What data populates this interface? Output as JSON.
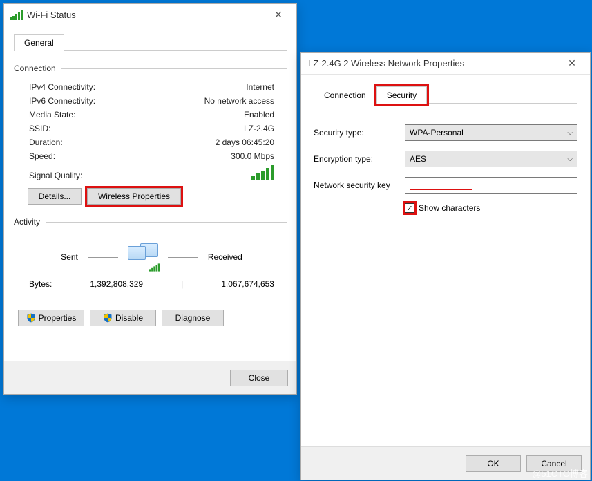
{
  "wifi": {
    "title": "Wi-Fi Status",
    "tab_general": "General",
    "group_connection": "Connection",
    "rows": {
      "ipv4_label": "IPv4 Connectivity:",
      "ipv4_value": "Internet",
      "ipv6_label": "IPv6 Connectivity:",
      "ipv6_value": "No network access",
      "media_label": "Media State:",
      "media_value": "Enabled",
      "ssid_label": "SSID:",
      "ssid_value": "LZ-2.4G",
      "duration_label": "Duration:",
      "duration_value": "2 days 06:45:20",
      "speed_label": "Speed:",
      "speed_value": "300.0 Mbps",
      "signal_label": "Signal Quality:"
    },
    "btn_details": "Details...",
    "btn_wireless": "Wireless Properties",
    "group_activity": "Activity",
    "sent_label": "Sent",
    "received_label": "Received",
    "bytes_label": "Bytes:",
    "bytes_sent": "1,392,808,329",
    "bytes_recv": "1,067,674,653",
    "btn_properties": "Properties",
    "btn_disable": "Disable",
    "btn_diagnose": "Diagnose",
    "btn_close": "Close"
  },
  "props": {
    "title": "LZ-2.4G 2 Wireless Network Properties",
    "tab_connection": "Connection",
    "tab_security": "Security",
    "sec_type_label": "Security type:",
    "sec_type_value": "WPA-Personal",
    "enc_type_label": "Encryption type:",
    "enc_type_value": "AES",
    "key_label": "Network security key",
    "key_value": "",
    "show_chars": "Show characters",
    "btn_ok": "OK",
    "btn_cancel": "Cancel"
  },
  "watermark": "@51CTO博客"
}
